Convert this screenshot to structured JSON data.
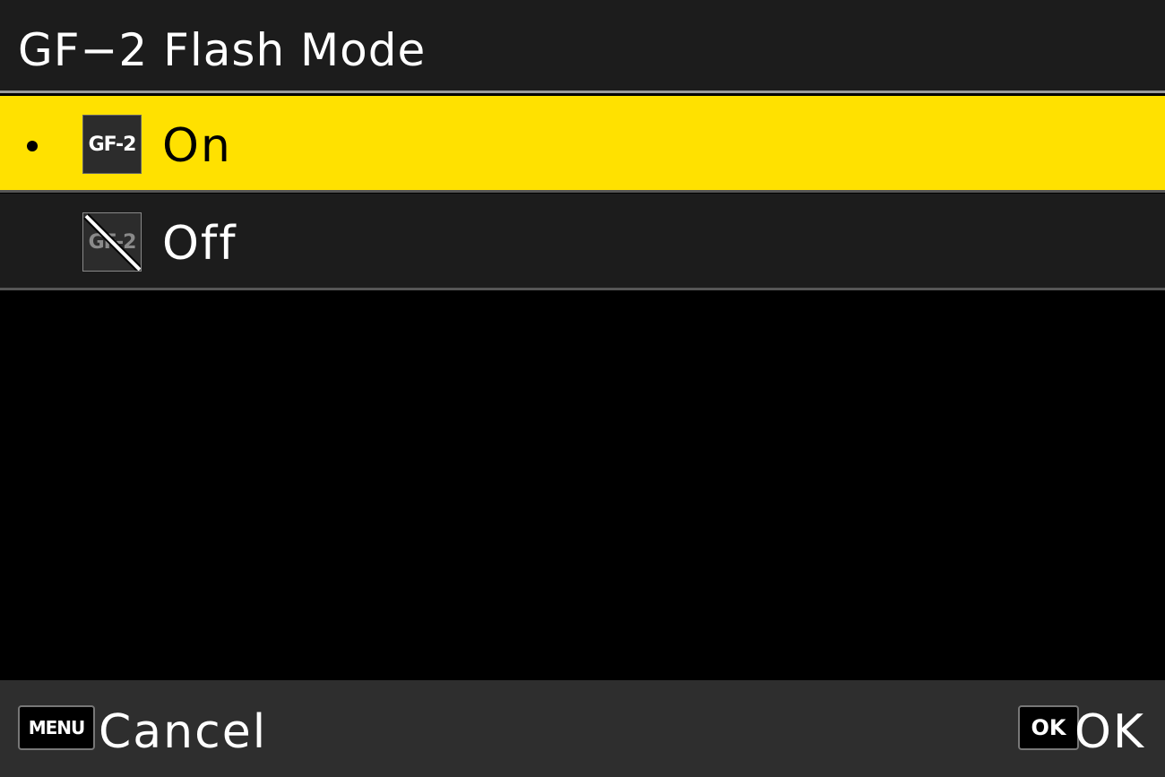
{
  "header": {
    "title": "GF−2 Flash Mode"
  },
  "options": [
    {
      "label": "On",
      "icon": "gf2-flash-on-icon",
      "icon_text": "GF-2",
      "selected": true
    },
    {
      "label": "Off",
      "icon": "gf2-flash-off-icon",
      "icon_text": "GF-2",
      "selected": false
    }
  ],
  "footer": {
    "cancel_key": "MENU",
    "cancel_label": "Cancel",
    "ok_key": "OK",
    "ok_label": "OK"
  },
  "colors": {
    "highlight": "#ffe100",
    "background": "#000000",
    "header_bg": "#1c1c1c",
    "footer_bg": "#2e2e2e"
  }
}
